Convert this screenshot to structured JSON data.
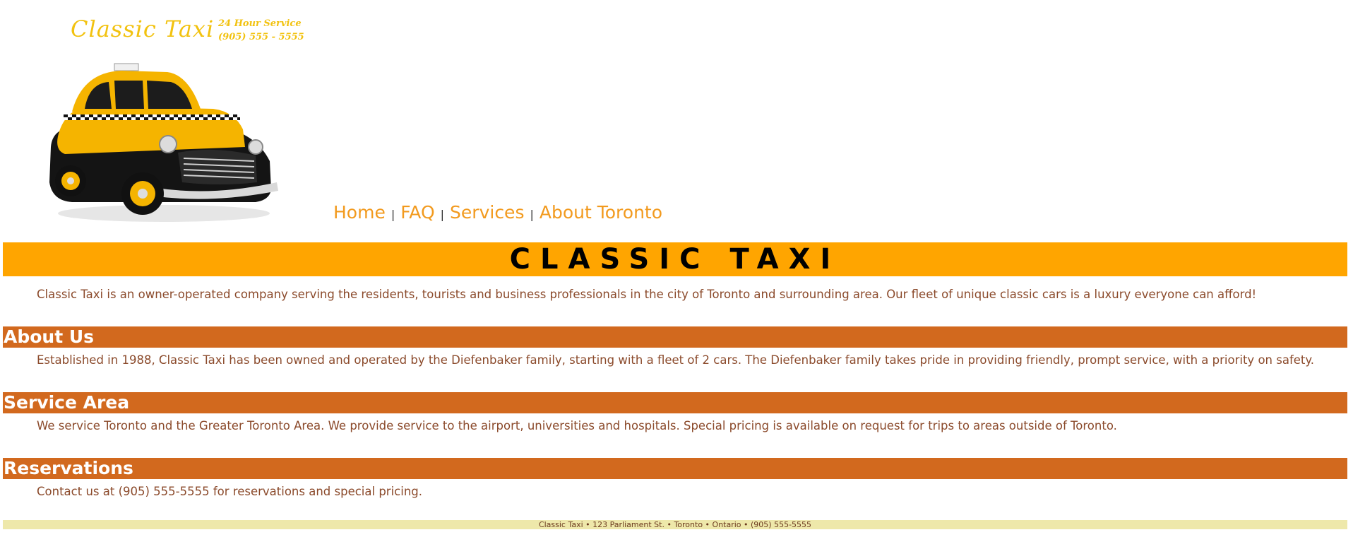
{
  "header": {
    "logo_title": "Classic Taxi",
    "service_line": "24 Hour Service",
    "phone_line": "(905) 555 - 5555",
    "taxi_image_icon": "taxi-car-illustration"
  },
  "nav": {
    "items": [
      {
        "label": "Home"
      },
      {
        "label": "FAQ"
      },
      {
        "label": "Services"
      },
      {
        "label": "About Toronto"
      }
    ],
    "separator": "|"
  },
  "banner": {
    "title": "CLASSIC  TAXI"
  },
  "intro": {
    "text": "Classic Taxi is an owner-operated company serving the residents, tourists and business professionals in the city of Toronto and surrounding area. Our fleet of unique classic cars is a luxury everyone can afford!"
  },
  "sections": [
    {
      "heading": "About Us",
      "text": "Established in 1988, Classic Taxi has been owned and operated by the Diefenbaker family, starting with a fleet of 2 cars. The Diefenbaker family takes pride in providing friendly, prompt service, with a priority on safety."
    },
    {
      "heading": "Service Area",
      "text": "We service Toronto and the Greater Toronto Area. We provide service to the airport, universities and hospitals. Special pricing is available on request for trips to areas outside of Toronto."
    },
    {
      "heading": "Reservations",
      "text": "Contact us at (905) 555-5555 for reservations and special pricing."
    }
  ],
  "footer": {
    "text": "Classic Taxi • 123 Parliament St. • Toronto • Ontario • (905) 555-5555"
  },
  "colors": {
    "logo": "#f2c20f",
    "nav_link": "#f29a1e",
    "banner": "#ffa500",
    "section_heading": "#d2691e",
    "body_text": "#8b4a2b",
    "footer_bg": "#eee8aa"
  }
}
